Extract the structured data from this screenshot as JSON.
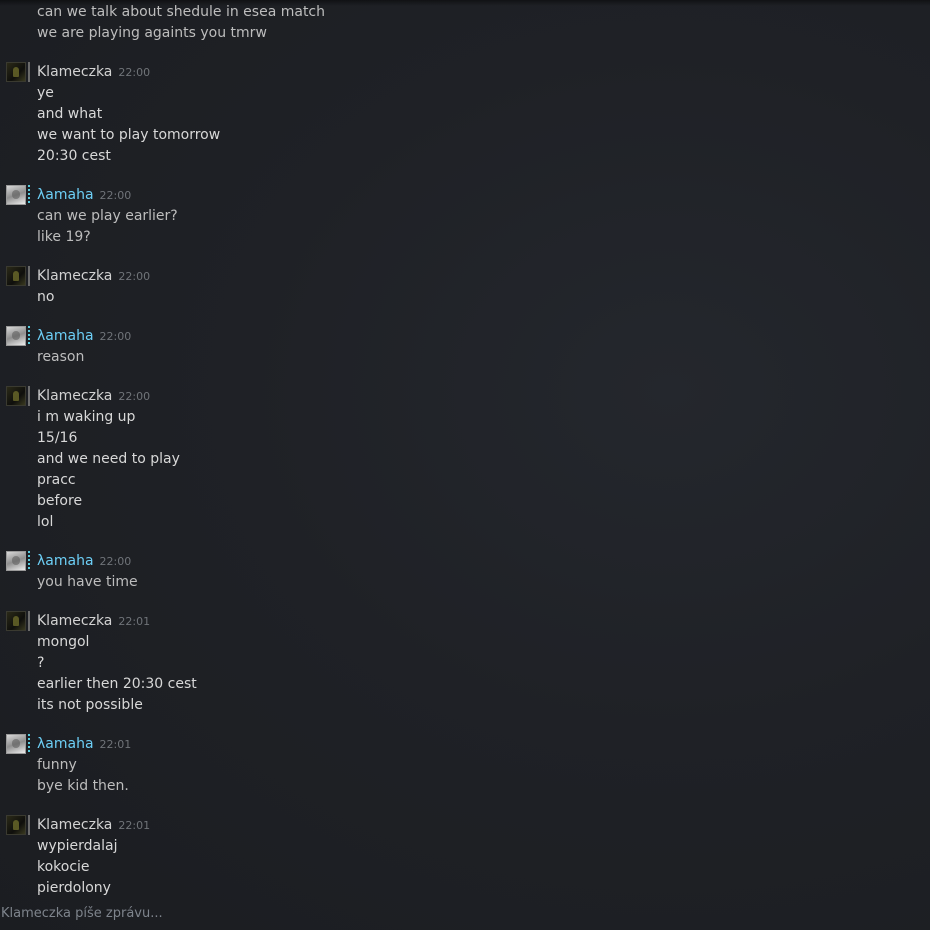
{
  "typing_indicator": "Klameczka píše zprávu...",
  "groups": [
    {
      "sender": "",
      "time": "",
      "kind": "online",
      "show_header": false,
      "lines": [
        "can we talk about shedule in esea match",
        "we are playing againts you tmrw"
      ]
    },
    {
      "sender": "Klameczka",
      "time": "22:00",
      "kind": "offline",
      "show_header": true,
      "lines": [
        "ye",
        "and what",
        "we want to play tomorrow",
        "20:30 cest"
      ]
    },
    {
      "sender": "λamaha",
      "time": "22:00",
      "kind": "online",
      "show_header": true,
      "lines": [
        "can we play earlier?",
        "like 19?"
      ]
    },
    {
      "sender": "Klameczka",
      "time": "22:00",
      "kind": "offline",
      "show_header": true,
      "lines": [
        "no"
      ]
    },
    {
      "sender": "λamaha",
      "time": "22:00",
      "kind": "online",
      "show_header": true,
      "lines": [
        "reason"
      ]
    },
    {
      "sender": "Klameczka",
      "time": "22:00",
      "kind": "offline",
      "show_header": true,
      "lines": [
        "i m waking up",
        "15/16",
        "and we need to play",
        "pracc",
        "before",
        "lol"
      ]
    },
    {
      "sender": "λamaha",
      "time": "22:00",
      "kind": "online",
      "show_header": true,
      "lines": [
        "you have time"
      ]
    },
    {
      "sender": "Klameczka",
      "time": "22:01",
      "kind": "offline",
      "show_header": true,
      "lines": [
        "mongol",
        "?",
        "earlier then 20:30 cest",
        "its not possible"
      ]
    },
    {
      "sender": "λamaha",
      "time": "22:01",
      "kind": "online",
      "show_header": true,
      "lines": [
        "funny",
        "bye kid then."
      ]
    },
    {
      "sender": "Klameczka",
      "time": "22:01",
      "kind": "offline",
      "show_header": true,
      "lines": [
        "wypierdalaj",
        "kokocie",
        "pierdolony"
      ]
    }
  ]
}
